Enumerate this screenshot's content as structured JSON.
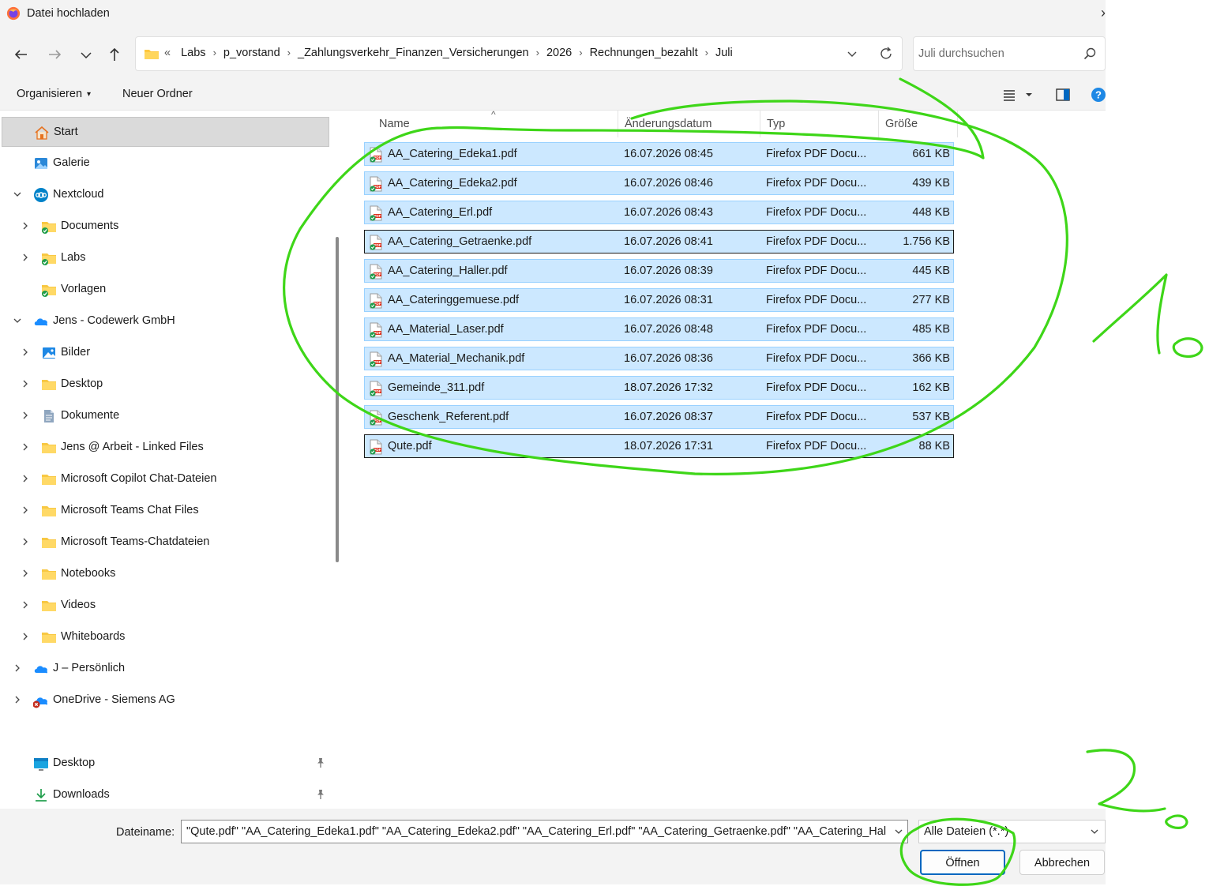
{
  "window": {
    "title": "Datei hochladen",
    "close_glyph": "›"
  },
  "address": {
    "overflow": "«",
    "crumbs": [
      "Labs",
      "p_vorstand",
      "_Zahlungsverkehr_Finanzen_Versicherungen",
      "2026",
      "Rechnungen_bezahlt",
      "Juli"
    ],
    "separator": "›"
  },
  "search": {
    "placeholder": "Juli durchsuchen"
  },
  "toolbar": {
    "organize_label": "Organisieren",
    "organize_caret": "▾",
    "new_folder_label": "Neuer Ordner"
  },
  "sidebar": {
    "items": [
      {
        "label": "Start",
        "icon": "home-icon"
      },
      {
        "label": "Galerie",
        "icon": "gallery-icon"
      },
      {
        "label": "Nextcloud",
        "icon": "nextcloud-icon"
      },
      {
        "label": "Documents",
        "icon": "synced-folder-icon"
      },
      {
        "label": "Labs",
        "icon": "synced-folder-icon"
      },
      {
        "label": "Vorlagen",
        "icon": "synced-folder-icon"
      },
      {
        "label": "Jens - Codewerk GmbH",
        "icon": "onedrive-icon"
      },
      {
        "label": "Bilder",
        "icon": "pictures-icon"
      },
      {
        "label": "Desktop",
        "icon": "folder-icon"
      },
      {
        "label": "Dokumente",
        "icon": "document-icon"
      },
      {
        "label": "Jens @ Arbeit - Linked Files",
        "icon": "folder-icon"
      },
      {
        "label": "Microsoft Copilot Chat-Dateien",
        "icon": "folder-icon"
      },
      {
        "label": "Microsoft Teams Chat Files",
        "icon": "folder-icon"
      },
      {
        "label": "Microsoft Teams-Chatdateien",
        "icon": "folder-icon"
      },
      {
        "label": "Notebooks",
        "icon": "folder-icon"
      },
      {
        "label": "Videos",
        "icon": "folder-icon"
      },
      {
        "label": "Whiteboards",
        "icon": "folder-icon"
      },
      {
        "label": "J – Persönlich",
        "icon": "onedrive-icon"
      },
      {
        "label": "OneDrive - Siemens AG",
        "icon": "onedrive-error-icon"
      }
    ],
    "quick_access": [
      {
        "label": "Desktop",
        "icon": "desktop-icon"
      },
      {
        "label": "Downloads",
        "icon": "download-icon"
      }
    ]
  },
  "columns": {
    "name": "Name",
    "date": "Änderungsdatum",
    "type": "Typ",
    "size": "Größe"
  },
  "files": [
    {
      "name": "AA_Catering_Edeka1.pdf",
      "date": "16.07.2026 08:45",
      "type": "Firefox PDF Docu...",
      "size": "661 KB"
    },
    {
      "name": "AA_Catering_Edeka2.pdf",
      "date": "16.07.2026 08:46",
      "type": "Firefox PDF Docu...",
      "size": "439 KB"
    },
    {
      "name": "AA_Catering_Erl.pdf",
      "date": "16.07.2026 08:43",
      "type": "Firefox PDF Docu...",
      "size": "448 KB"
    },
    {
      "name": "AA_Catering_Getraenke.pdf",
      "date": "16.07.2026 08:41",
      "type": "Firefox PDF Docu...",
      "size": "1.756 KB"
    },
    {
      "name": "AA_Catering_Haller.pdf",
      "date": "16.07.2026 08:39",
      "type": "Firefox PDF Docu...",
      "size": "445 KB"
    },
    {
      "name": "AA_Cateringgemuese.pdf",
      "date": "16.07.2026 08:31",
      "type": "Firefox PDF Docu...",
      "size": "277 KB"
    },
    {
      "name": "AA_Material_Laser.pdf",
      "date": "16.07.2026 08:48",
      "type": "Firefox PDF Docu...",
      "size": "485 KB"
    },
    {
      "name": "AA_Material_Mechanik.pdf",
      "date": "16.07.2026 08:36",
      "type": "Firefox PDF Docu...",
      "size": "366 KB"
    },
    {
      "name": "Gemeinde_311.pdf",
      "date": "18.07.2026 17:32",
      "type": "Firefox PDF Docu...",
      "size": "162 KB"
    },
    {
      "name": "Geschenk_Referent.pdf",
      "date": "16.07.2026 08:37",
      "type": "Firefox PDF Docu...",
      "size": "537 KB"
    },
    {
      "name": "Qute.pdf",
      "date": "18.07.2026 17:31",
      "type": "Firefox PDF Docu...",
      "size": "88 KB"
    }
  ],
  "footer": {
    "filename_label": "Dateiname:",
    "filename_value": "\"Qute.pdf\" \"AA_Catering_Edeka1.pdf\" \"AA_Catering_Edeka2.pdf\" \"AA_Catering_Erl.pdf\" \"AA_Catering_Getraenke.pdf\" \"AA_Catering_Hall",
    "filetype_value": "Alle Dateien (*.*)",
    "open_label": "Öffnen",
    "cancel_label": "Abbrechen"
  },
  "colors": {
    "selection_fill": "#cce8ff",
    "selection_border": "#99d1ff",
    "annotation_stroke": "#3ed618",
    "accent": "#0067c0"
  }
}
